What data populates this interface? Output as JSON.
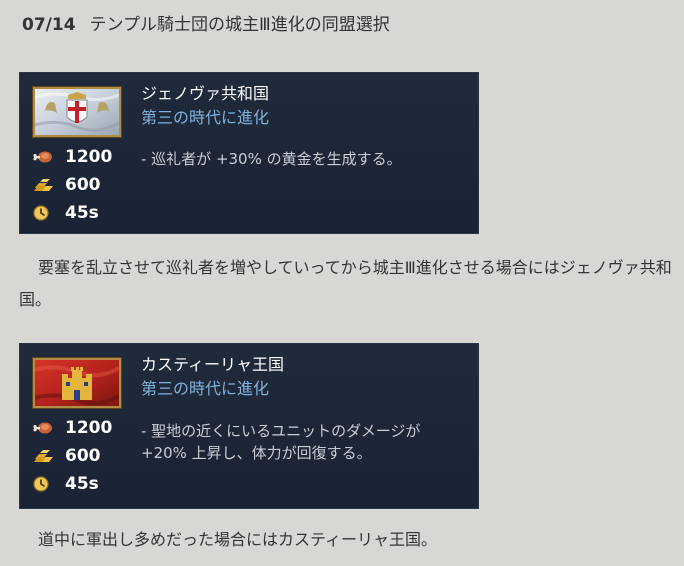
{
  "heading": {
    "date": "07/14",
    "title": "テンプル騎士団の城主Ⅲ進化の同盟選択"
  },
  "cards": [
    {
      "name": "ジェノヴァ共和国",
      "subtitle": "第三の時代に進化",
      "food": "1200",
      "gold": "600",
      "time": "45s",
      "description": "- 巡礼者が +30% の黄金を生成する。",
      "emblem": "genoa-flag-emblem"
    },
    {
      "name": "カスティーリャ王国",
      "subtitle": "第三の時代に進化",
      "food": "1200",
      "gold": "600",
      "time": "45s",
      "description": "- 聖地の近くにいるユニットのダメージが +20% 上昇し、体力が回復する。",
      "emblem": "castile-flag-emblem"
    }
  ],
  "paragraphs": [
    "要塞を乱立させて巡礼者を増やしていってから城主Ⅲ進化させる場合にはジェノヴァ共和国。",
    "道中に軍出し多めだった場合にはカスティーリャ王国。"
  ],
  "icons": {
    "food": "meat-icon",
    "gold": "gold-icon",
    "time": "clock-icon"
  },
  "colors": {
    "background": "#d9d7d4",
    "card": "#1f2a3b",
    "subtitle": "#7fb1dd",
    "frame": "#b28b44"
  }
}
